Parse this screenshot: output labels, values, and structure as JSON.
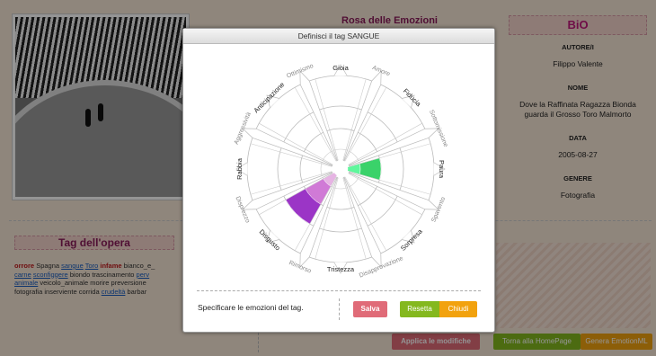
{
  "rosa_title": "Rosa delle Emozioni",
  "bio": {
    "title": "BiO",
    "fields": [
      {
        "label": "AUTORE/I",
        "value": "Filippo Valente"
      },
      {
        "label": "NOME",
        "value": "Dove la Raffinata Ragazza Bionda guarda il Grosso Toro Malmorto"
      },
      {
        "label": "DATA",
        "value": "2005-08-27"
      },
      {
        "label": "GENERE",
        "value": "Fotografia"
      }
    ]
  },
  "tag_panel": {
    "title": "Tag dell'opera",
    "tags_line1_a": "orrore",
    "tags_line1_b": "Spagna",
    "tags_line1_c": "sangue",
    "tags_line1_d": "Toro",
    "tags_line1_e": "infame",
    "tags_line1_f": "bianco_e_",
    "tags_line2_a": "carne",
    "tags_line2_b": "sconfiggere",
    "tags_line2_c": "biondo trascinamento",
    "tags_line2_d": "perv",
    "tags_line3_a": "animale",
    "tags_line3_b": "veicolo_animale morire preversione",
    "tags_line4_a": "fotografia inserviente corrida",
    "tags_line4_b": "crudeltà",
    "tags_line4_c": "barbar"
  },
  "bottom_buttons": {
    "apply": "Applica le modifiche",
    "home": "Torna alla HomePage",
    "emotion": "Genera EmotionML"
  },
  "modal": {
    "title": "Definisci il tag SANGUE",
    "footer_text": "Specificare le emozioni del tag.",
    "save": "Salva",
    "reset": "Resetta",
    "close": "Chiudi"
  },
  "emotions": [
    {
      "name": "Gioia",
      "type": "primary",
      "level": 0
    },
    {
      "name": "Amore",
      "type": "compound",
      "level": 0
    },
    {
      "name": "Fiducia",
      "type": "primary",
      "level": 0
    },
    {
      "name": "Sottomissione",
      "type": "compound",
      "level": 0
    },
    {
      "name": "Paura",
      "type": "primary",
      "level": 2
    },
    {
      "name": "Spavento",
      "type": "compound",
      "level": 0
    },
    {
      "name": "Sorpresa",
      "type": "primary",
      "level": 0
    },
    {
      "name": "Disapprovazione",
      "type": "compound",
      "level": 0
    },
    {
      "name": "Tristezza",
      "type": "primary",
      "level": 0
    },
    {
      "name": "Rimorso",
      "type": "compound",
      "level": 0
    },
    {
      "name": "Disgusto",
      "type": "primary",
      "level": 3
    },
    {
      "name": "Disprezzo",
      "type": "compound",
      "level": 0
    },
    {
      "name": "Rabbia",
      "type": "primary",
      "level": 0
    },
    {
      "name": "Aggressività",
      "type": "compound",
      "level": 0
    },
    {
      "name": "Anticipazione",
      "type": "primary",
      "level": 0
    },
    {
      "name": "Ottimismo",
      "type": "compound",
      "level": 0
    }
  ],
  "colors": {
    "paura": [
      "#5ff79c",
      "#3ad26a",
      "#238c20"
    ],
    "disgusto": [
      "#e6b4e3",
      "#d07ad6",
      "#9b35c6"
    ],
    "accent": "#c0187a"
  }
}
